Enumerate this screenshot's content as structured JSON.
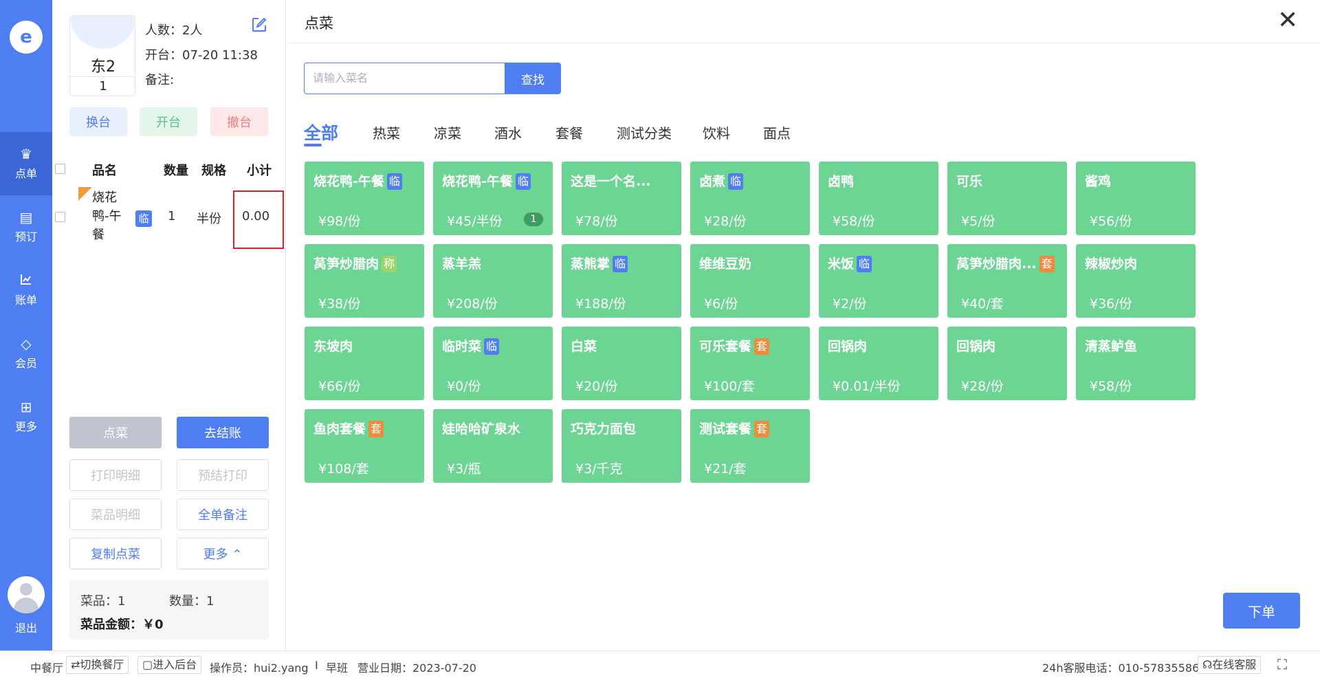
{
  "nav": {
    "logo_glyph": "e",
    "items": [
      {
        "label": "点单",
        "icon": "chef-hat-icon",
        "glyph": "♛"
      },
      {
        "label": "预订",
        "icon": "booking-icon",
        "glyph": "▤"
      },
      {
        "label": "账单",
        "icon": "bill-chart-icon",
        "glyph": "📈"
      },
      {
        "label": "会员",
        "icon": "member-diamond-icon",
        "glyph": "◇"
      },
      {
        "label": "更多",
        "icon": "more-grid-icon",
        "glyph": "⊞"
      }
    ],
    "logout": "退出"
  },
  "order": {
    "table_name": "东2",
    "table_no": "1",
    "people": "人数：2人",
    "opened": "开台：07-20 11:38",
    "note": "备注:",
    "actions": {
      "swap": "换台",
      "open": "开台",
      "clear": "撤台"
    },
    "columns": {
      "name": "品名",
      "qty": "数量",
      "spec": "规格",
      "subtotal": "小计"
    },
    "items": [
      {
        "name": "烧花鸭-午餐",
        "tag": "临",
        "qty": "1",
        "spec": "半份",
        "subtotal": "0.00"
      }
    ],
    "buttons": {
      "order": "点菜",
      "pay": "去结账",
      "print_detail": "打印明细",
      "pre_print": "预结打印",
      "dish_detail": "菜品明细",
      "full_note": "全单备注",
      "copy_order": "复制点菜",
      "more": "更多 ⌃"
    },
    "summary": {
      "dishes": "菜品：1",
      "count": "数量：1",
      "amount": "菜品金额：￥0"
    }
  },
  "menu": {
    "title": "点菜",
    "search_placeholder": "请输入菜名",
    "search_button": "查找",
    "categories": [
      "全部",
      "热菜",
      "凉菜",
      "酒水",
      "套餐",
      "测试分类",
      "饮料",
      "面点"
    ],
    "dishes": [
      {
        "name": "烧花鸭-午餐",
        "badge": "临",
        "badge_type": "lin",
        "price": "¥98/份"
      },
      {
        "name": "烧花鸭-午餐",
        "badge": "临",
        "badge_type": "lin",
        "price": "¥45/半份",
        "count": "1"
      },
      {
        "name": "这是一个名...",
        "badge": "",
        "badge_type": "",
        "price": "¥78/份"
      },
      {
        "name": "卤煮",
        "badge": "临",
        "badge_type": "lin",
        "price": "¥28/份"
      },
      {
        "name": "卤鸭",
        "badge": "",
        "badge_type": "",
        "price": "¥58/份"
      },
      {
        "name": "可乐",
        "badge": "",
        "badge_type": "",
        "price": "¥5/份"
      },
      {
        "name": "酱鸡",
        "badge": "",
        "badge_type": "",
        "price": "¥56/份"
      },
      {
        "name": "莴笋炒腊肉",
        "badge": "称",
        "badge_type": "cheng",
        "price": "¥38/份"
      },
      {
        "name": "蒸羊羔",
        "badge": "",
        "badge_type": "",
        "price": "¥208/份"
      },
      {
        "name": "蒸熊掌",
        "badge": "临",
        "badge_type": "lin",
        "price": "¥188/份"
      },
      {
        "name": "维维豆奶",
        "badge": "",
        "badge_type": "",
        "price": "¥6/份"
      },
      {
        "name": "米饭",
        "badge": "临",
        "badge_type": "lin",
        "price": "¥2/份"
      },
      {
        "name": "莴笋炒腊肉...",
        "badge": "套",
        "badge_type": "tao",
        "price": "¥40/套"
      },
      {
        "name": "辣椒炒肉",
        "badge": "",
        "badge_type": "",
        "price": "¥36/份"
      },
      {
        "name": "东坡肉",
        "badge": "",
        "badge_type": "",
        "price": "¥66/份"
      },
      {
        "name": "临时菜",
        "badge": "临",
        "badge_type": "lin",
        "price": "¥0/份"
      },
      {
        "name": "白菜",
        "badge": "",
        "badge_type": "",
        "price": "¥20/份"
      },
      {
        "name": "可乐套餐",
        "badge": "套",
        "badge_type": "tao",
        "price": "¥100/套"
      },
      {
        "name": "回锅肉",
        "badge": "",
        "badge_type": "",
        "price": "¥0.01/半份"
      },
      {
        "name": "回锅肉",
        "badge": "",
        "badge_type": "",
        "price": "¥28/份"
      },
      {
        "name": "清蒸鲈鱼",
        "badge": "",
        "badge_type": "",
        "price": "¥58/份"
      },
      {
        "name": "鱼肉套餐",
        "badge": "套",
        "badge_type": "tao",
        "price": "¥108/套"
      },
      {
        "name": "娃哈哈矿泉水",
        "badge": "",
        "badge_type": "",
        "price": "¥3/瓶"
      },
      {
        "name": "巧克力面包",
        "badge": "",
        "badge_type": "",
        "price": "¥3/千克"
      },
      {
        "name": "测试套餐",
        "badge": "套",
        "badge_type": "tao",
        "price": "¥21/套"
      }
    ],
    "submit": "下单"
  },
  "statusbar": {
    "restaurant": "中餐厅",
    "switch": "⇄切换餐厅",
    "backend": "▢进入后台",
    "operator": "操作员：hui2.yang",
    "divider": "I",
    "shift": "早班",
    "biz_date": "营业日期：2023-07-20",
    "hotline": "24h客服电话：010-57835586",
    "online": "☊在线客服",
    "fullscreen_glyph": "⛶"
  },
  "colors": {
    "primary": "#4f7ef2",
    "card": "#6dd594",
    "highlight": "#e02020"
  }
}
